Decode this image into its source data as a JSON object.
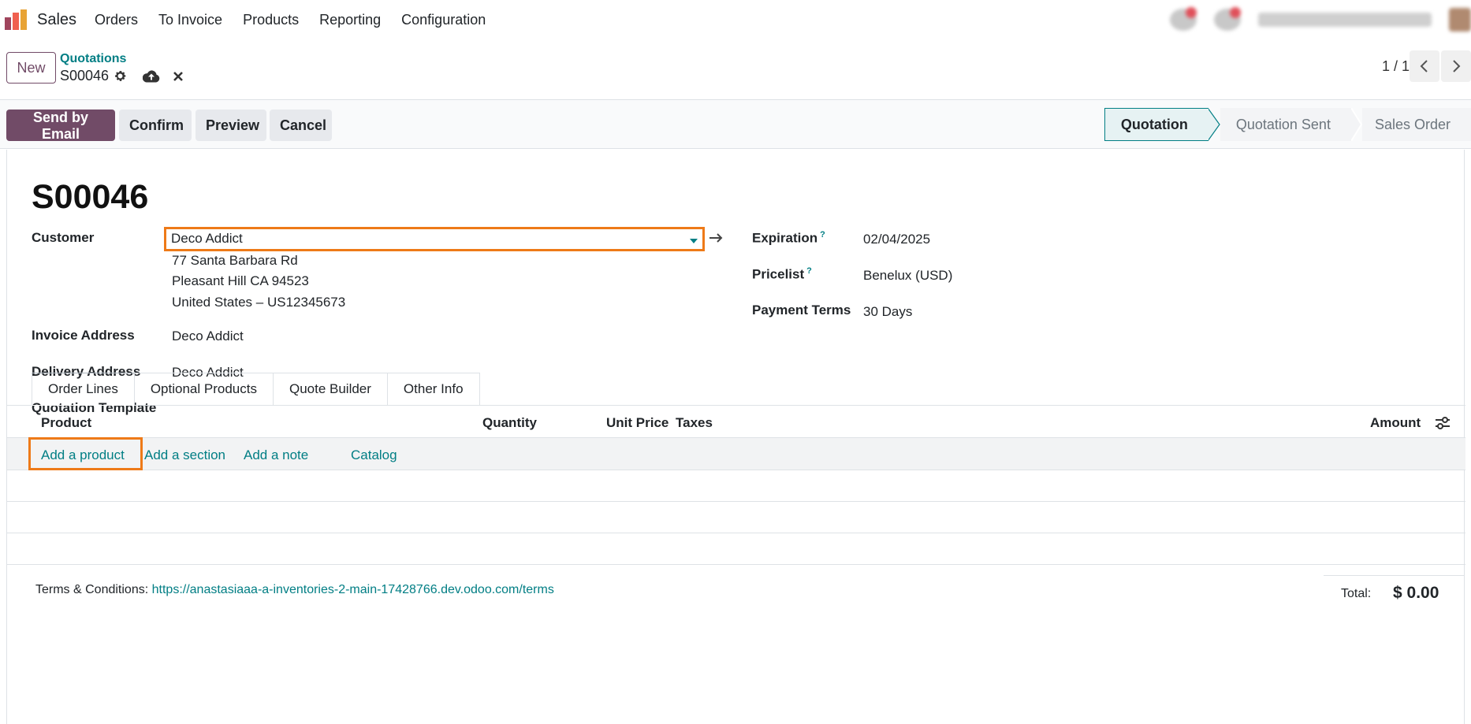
{
  "navbar": {
    "app_name": "Sales",
    "menu": [
      "Orders",
      "To Invoice",
      "Products",
      "Reporting",
      "Configuration"
    ],
    "logo_colors": [
      "#e8a335",
      "#f06050",
      "#a0455d"
    ]
  },
  "control": {
    "new_label": "New",
    "breadcrumb": "Quotations",
    "record_name": "S00046",
    "pager": "1 / 1"
  },
  "actions": {
    "send_by_email": "Send by Email",
    "confirm": "Confirm",
    "preview": "Preview",
    "cancel": "Cancel"
  },
  "status": {
    "stages": [
      "Quotation",
      "Quotation Sent",
      "Sales Order"
    ],
    "active": "Quotation"
  },
  "form": {
    "title": "S00046",
    "customer_label": "Customer",
    "customer_value": "Deco Addict",
    "address_line1": "77 Santa Barbara Rd",
    "address_line2": "Pleasant Hill CA 94523",
    "address_line3": "United States – US12345673",
    "invoice_address_label": "Invoice Address",
    "invoice_address_value": "Deco Addict",
    "delivery_address_label": "Delivery Address",
    "delivery_address_value": "Deco Addict",
    "quotation_template_label": "Quotation Template",
    "expiration_label": "Expiration",
    "expiration_value": "02/04/2025",
    "pricelist_label": "Pricelist",
    "pricelist_value": "Benelux (USD)",
    "payment_terms_label": "Payment Terms",
    "payment_terms_value": "30 Days",
    "help_mark": "?"
  },
  "tabs": [
    "Order Lines",
    "Optional Products",
    "Quote Builder",
    "Other Info"
  ],
  "table": {
    "headers": {
      "product": "Product",
      "quantity": "Quantity",
      "unit_price": "Unit Price",
      "taxes": "Taxes",
      "amount": "Amount"
    },
    "add_product": "Add a product",
    "add_section": "Add a section",
    "add_note": "Add a note",
    "catalog": "Catalog"
  },
  "footer": {
    "terms_label": "Terms & Conditions:",
    "terms_url": "https://anastasiaaa-a-inventories-2-main-17428766.dev.odoo.com/terms",
    "total_label": "Total:",
    "total_value": "$ 0.00"
  },
  "colors": {
    "brand": "#714b67",
    "link": "#017e84",
    "highlight": "#ee7a18"
  }
}
